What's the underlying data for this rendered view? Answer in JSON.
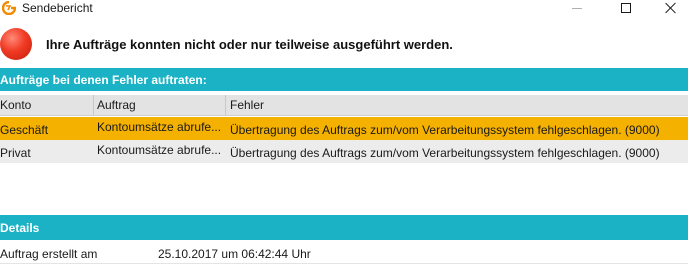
{
  "window": {
    "title": "Sendebericht",
    "colors": {
      "accent": "#1ab2c4",
      "highlight_row": "#f5b100",
      "error_icon": "#e8321e"
    }
  },
  "message": {
    "icon": "error-circle-icon",
    "headline": "Ihre Aufträge konnten nicht oder nur teilweise ausgeführt werden."
  },
  "errors_section": {
    "title": "Aufträge bei denen Fehler auftraten:",
    "columns": [
      "Konto",
      "Auftrag",
      "Fehler"
    ],
    "rows": [
      {
        "konto": "Geschäft",
        "auftrag": "Kontoumsätze abrufe...",
        "fehler": "Übertragung des Auftrags zum/vom Verarbeitungssystem fehlgeschlagen. (9000)",
        "selected": true
      },
      {
        "konto": "Privat",
        "auftrag": "Kontoumsätze abrufe...",
        "fehler": "Übertragung des Auftrags zum/vom Verarbeitungssystem fehlgeschlagen. (9000)",
        "selected": false
      }
    ]
  },
  "details_section": {
    "title": "Details",
    "items": [
      {
        "label": "Auftrag erstellt am",
        "value": "25.10.2017 um 06:42:44 Uhr"
      }
    ]
  }
}
